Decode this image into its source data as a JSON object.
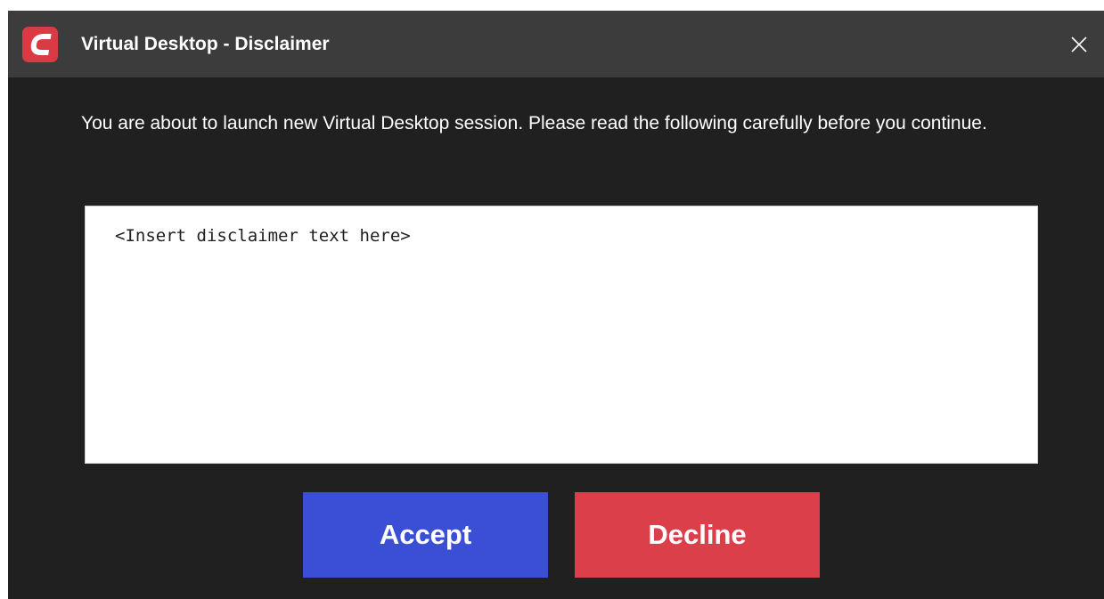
{
  "window": {
    "title": "Virtual Desktop - Disclaimer",
    "logo_icon": "comodo-c-logo-icon",
    "close_icon": "close-icon"
  },
  "intro_text": "You are about to launch new Virtual Desktop session. Please read the following carefully before you continue.",
  "disclaimer": {
    "text": "<Insert disclaimer text here>"
  },
  "buttons": {
    "accept_label": "Accept",
    "decline_label": "Decline"
  },
  "colors": {
    "titlebar": "#3c3c3c",
    "background": "#202020",
    "logo": "#d93a43",
    "accept": "#3b4ed6",
    "decline": "#db404a"
  }
}
